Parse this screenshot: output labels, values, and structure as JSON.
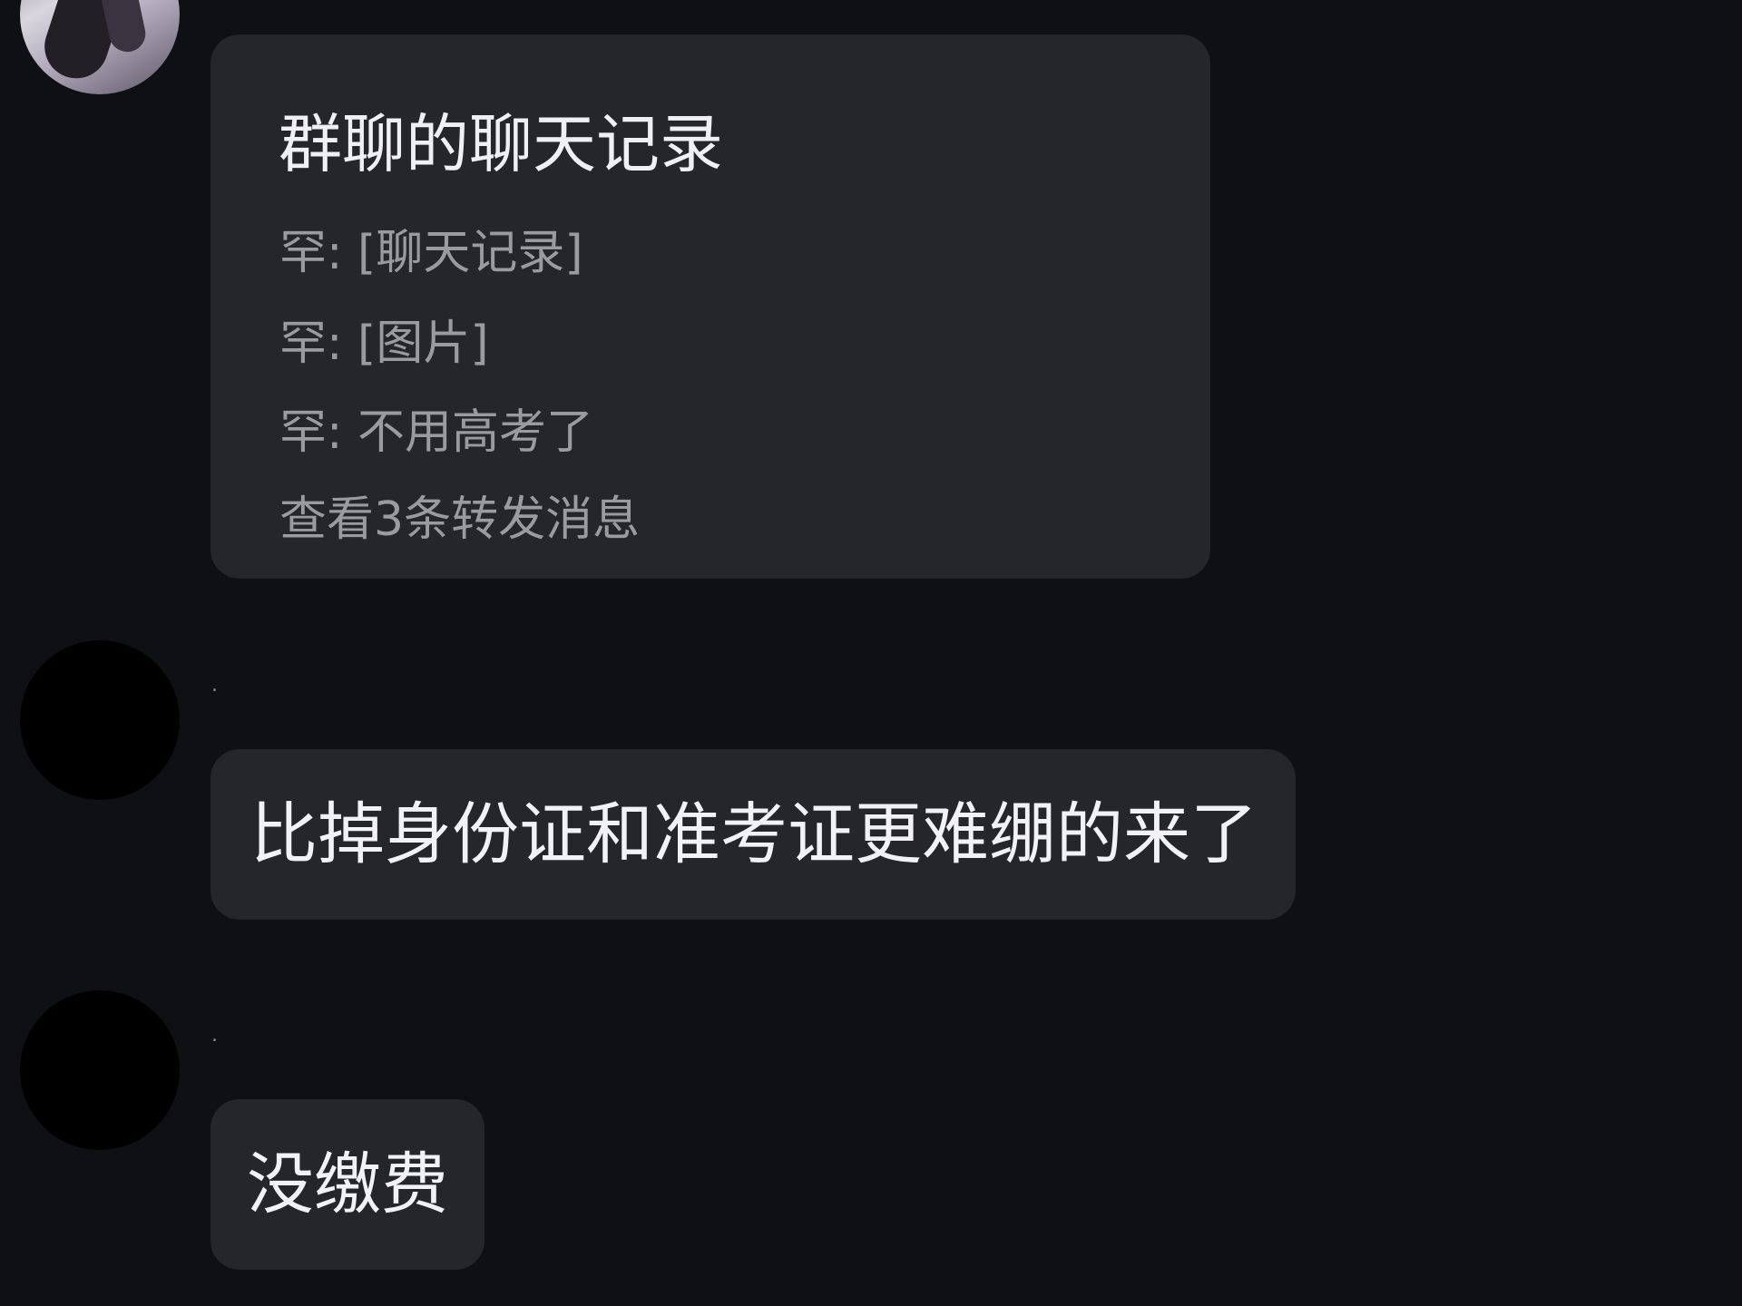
{
  "messages": [
    {
      "type": "forwarded-chat",
      "title": "群聊的聊天记录",
      "lines": [
        "罕: [聊天记录]",
        "罕: [图片]",
        "罕: 不用高考了"
      ],
      "footer": "查看3条转发消息"
    },
    {
      "sender": ".",
      "text": "比掉身份证和准考证更难绷的来了"
    },
    {
      "sender": ".",
      "text": "没缴费"
    }
  ]
}
